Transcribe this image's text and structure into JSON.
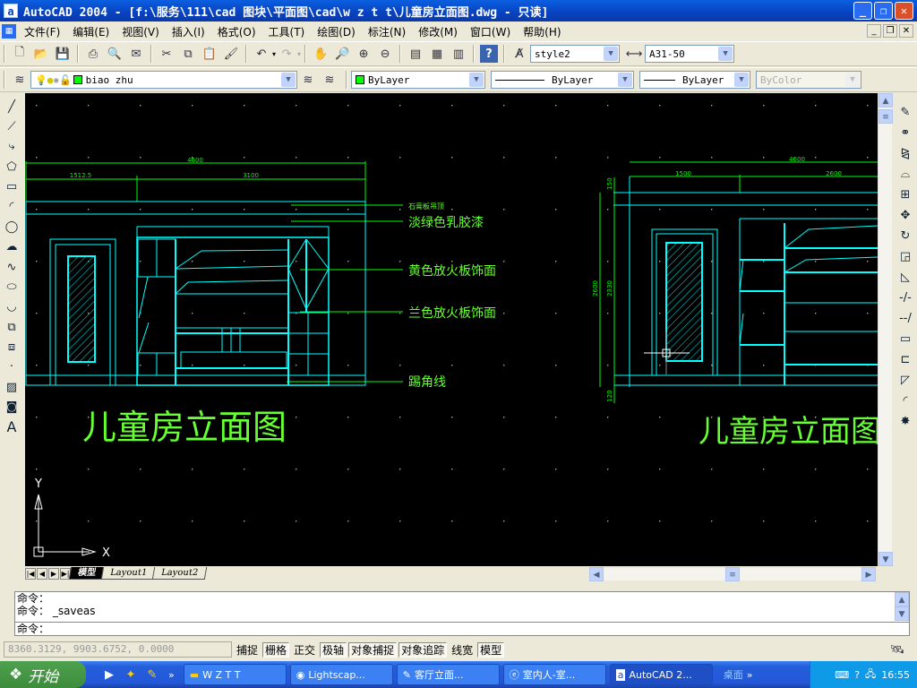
{
  "window": {
    "title": "AutoCAD 2004 - [f:\\服务\\111\\cad 图块\\平面图\\cad\\w z t t\\儿童房立面图.dwg - 只读]",
    "app_icon": "a"
  },
  "menu": [
    "文件(F)",
    "编辑(E)",
    "视图(V)",
    "插入(I)",
    "格式(O)",
    "工具(T)",
    "绘图(D)",
    "标注(N)",
    "修改(M)",
    "窗口(W)",
    "帮助(H)"
  ],
  "toolbar": {
    "text_style": "style2",
    "dim_style": "A31-50"
  },
  "layers": {
    "current_layer": "biao zhu",
    "color": "ByLayer",
    "linetype": "ByLayer",
    "lineweight": "ByLayer",
    "plot_style": "ByColor",
    "layer_color": "#00ff00"
  },
  "drawing": {
    "left": {
      "dim_total": "4600",
      "dim_a": "1512.5",
      "dim_b": "3100",
      "notes": [
        "石膏板吊顶",
        "淡绿色乳胶漆",
        "黄色放火板饰面",
        "兰色放火板饰面",
        "踢角线"
      ],
      "title": "儿童房立面图"
    },
    "right": {
      "dim_total": "4600",
      "dim_a": "1500",
      "dim_b": "2600",
      "dim_v_top": "150",
      "dim_v_total": "2600",
      "dim_v_mid": "2330",
      "dim_v_bot": "120",
      "title": "儿童房立面图"
    },
    "ucs": {
      "x": "X",
      "y": "Y"
    },
    "colors": {
      "background": "#000000",
      "lines": "#00ffff",
      "dims": "#00ff00",
      "text": "#66ff33"
    }
  },
  "tabs": [
    "模型",
    "Layout1",
    "Layout2"
  ],
  "command": {
    "history": [
      "命令：",
      "命令： _saveas"
    ],
    "prompt": "命令："
  },
  "status": {
    "coords": "8360.3129, 9903.6752, 0.0000",
    "toggles": [
      {
        "label": "捕捉",
        "on": false
      },
      {
        "label": "栅格",
        "on": true
      },
      {
        "label": "正交",
        "on": false
      },
      {
        "label": "极轴",
        "on": true
      },
      {
        "label": "对象捕捉",
        "on": true
      },
      {
        "label": "对象追踪",
        "on": true
      },
      {
        "label": "线宽",
        "on": false
      },
      {
        "label": "模型",
        "on": true
      }
    ]
  },
  "taskbar": {
    "start": "开始",
    "tasks": [
      "W Z T T",
      "Lightscap...",
      "客厅立面...",
      "室内人-室...",
      "AutoCAD 2..."
    ],
    "desktop": "桌面",
    "clock": "16:55"
  }
}
